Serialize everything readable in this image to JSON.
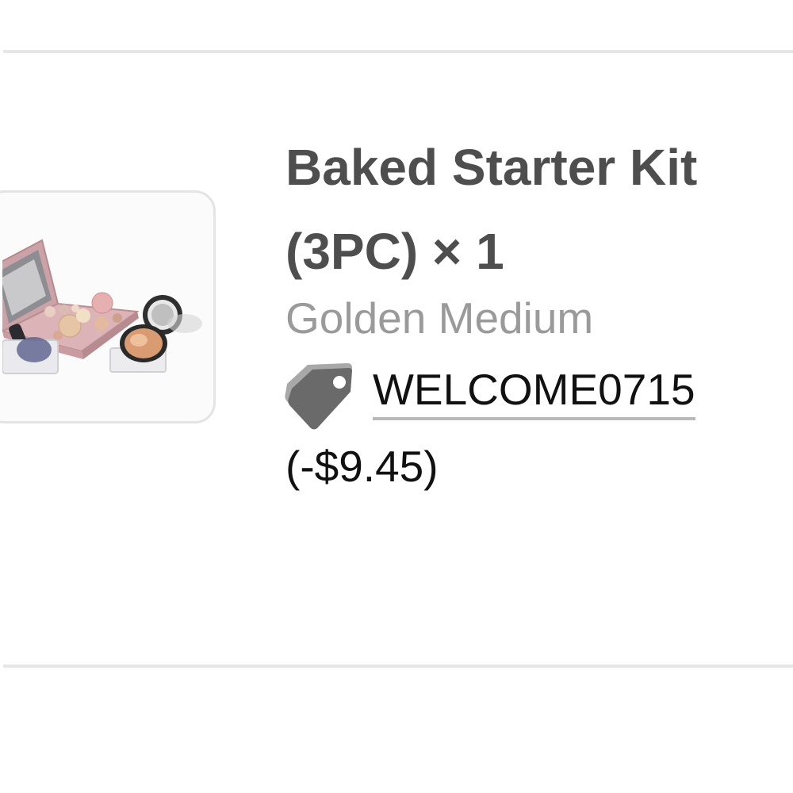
{
  "item": {
    "title_line1": "Baked Starter Kit",
    "title_line2": "(3PC) × 1",
    "variant": "Golden Medium",
    "promo_code": "WELCOME0715",
    "discount": "(-$9.45)"
  },
  "icons": {
    "tag": "price-tag-icon",
    "product": "product-thumbnail"
  },
  "colors": {
    "title": "#4e4e4e",
    "variant": "#9a9a9a",
    "text": "#111111",
    "divider": "#e6e6e6",
    "tag_icon": "#6a6a6a"
  }
}
